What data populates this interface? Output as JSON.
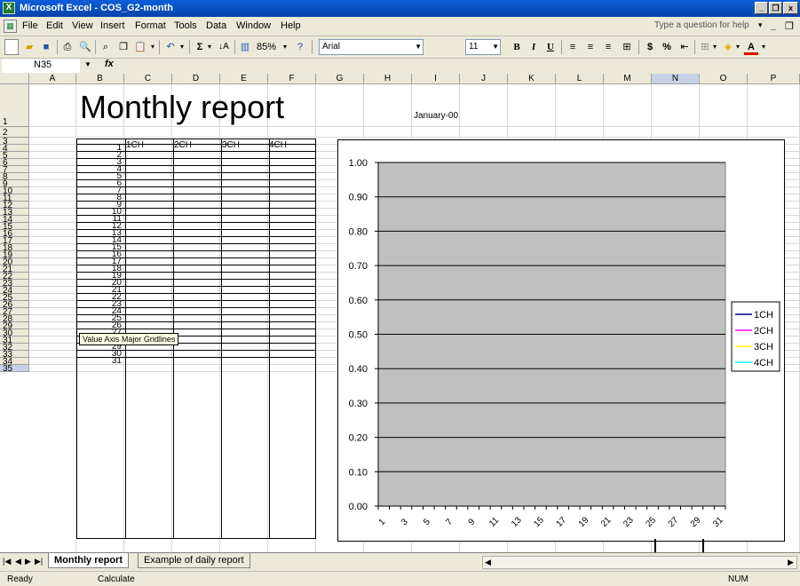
{
  "window": {
    "title": "Microsoft Excel - COS_G2-month",
    "app_icon": "excel-icon"
  },
  "menu": [
    "File",
    "Edit",
    "View",
    "Insert",
    "Format",
    "Tools",
    "Data",
    "Window",
    "Help"
  ],
  "question_placeholder": "Type a question for help",
  "toolbar": {
    "zoom": "85%",
    "font": "Arial",
    "font_size": "11",
    "bold": "B",
    "italic": "I",
    "underline": "U",
    "currency": "$",
    "percent": "%",
    "font_color": "A",
    "sum": "Σ"
  },
  "formula": {
    "name_box": "N35",
    "fx": "fx"
  },
  "grid": {
    "columns": [
      "A",
      "B",
      "C",
      "D",
      "E",
      "F",
      "G",
      "H",
      "I",
      "J",
      "K",
      "L",
      "M",
      "N",
      "O",
      "P"
    ],
    "rows": [
      "1",
      "2",
      "3",
      "4",
      "5",
      "6",
      "7",
      "8",
      "9",
      "10",
      "11",
      "12",
      "13",
      "14",
      "15",
      "16",
      "17",
      "18",
      "19",
      "20",
      "21",
      "22",
      "23",
      "24",
      "25",
      "26",
      "27",
      "28",
      "29",
      "30",
      "31",
      "32",
      "33",
      "34",
      "35"
    ],
    "report_title": "Monthly report",
    "month": "January-00",
    "table_headers": [
      "1CH",
      "2CH",
      "3CH",
      "4CH"
    ],
    "days": [
      "1",
      "2",
      "3",
      "4",
      "5",
      "6",
      "7",
      "8",
      "9",
      "10",
      "11",
      "12",
      "13",
      "14",
      "15",
      "16",
      "17",
      "18",
      "19",
      "20",
      "21",
      "22",
      "23",
      "24",
      "25",
      "26",
      "27",
      "28",
      "29",
      "30",
      "31"
    ]
  },
  "chart_data": {
    "type": "line",
    "x": [
      "1",
      "3",
      "5",
      "7",
      "9",
      "11",
      "13",
      "15",
      "17",
      "19",
      "21",
      "23",
      "25",
      "27",
      "29",
      "31"
    ],
    "yticks": [
      "1.00",
      "0.90",
      "0.80",
      "0.70",
      "0.60",
      "0.50",
      "0.40",
      "0.30",
      "0.20",
      "0.10",
      "0.00"
    ],
    "ylim": [
      0,
      1
    ],
    "grid": true,
    "plot_area_color": "#c0c0c0",
    "legend_position": "right",
    "series": [
      {
        "name": "1CH",
        "color": "#000080",
        "values": []
      },
      {
        "name": "2CH",
        "color": "#ff00ff",
        "values": []
      },
      {
        "name": "3CH",
        "color": "#ffff00",
        "values": []
      },
      {
        "name": "4CH",
        "color": "#00ffff",
        "values": []
      }
    ],
    "tooltip": "Value Axis Major Gridlines"
  },
  "sheets": {
    "tabs": [
      "Monthly report",
      "Example of daily report"
    ],
    "active": "Monthly report"
  },
  "status": {
    "left": "Ready",
    "mode": "Calculate",
    "num": "NUM"
  }
}
